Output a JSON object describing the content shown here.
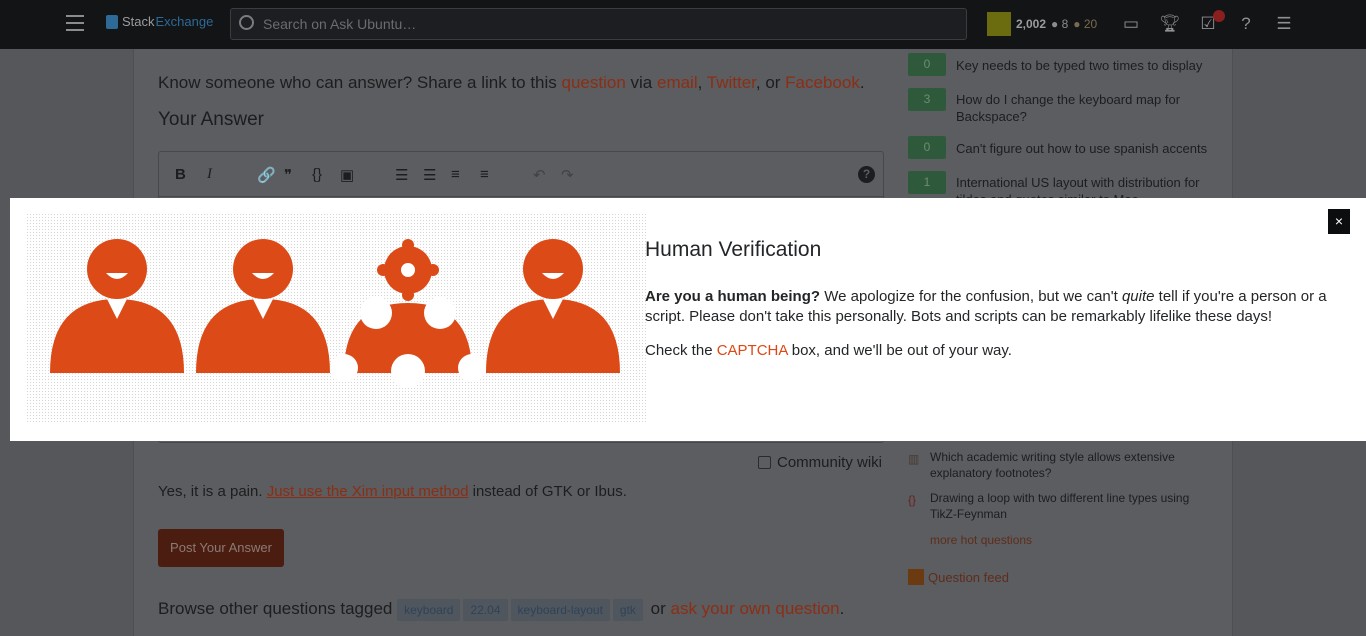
{
  "topbar": {
    "logo_stack": "Stack",
    "logo_exchange": "Exchange",
    "search_placeholder": "Search on Ask Ubuntu…",
    "reputation": "2,002",
    "silver": "● 8",
    "bronze": "● 20"
  },
  "main": {
    "share_prefix": "Know someone who can answer? Share a link to this ",
    "share_question": "question",
    "share_via": " via ",
    "share_email": "email",
    "sep1": ", ",
    "share_twitter": "Twitter",
    "sep2": ", or ",
    "share_facebook": "Facebook",
    "share_end": ".",
    "your_answer": "Your Answer",
    "toolbar": {
      "bold": "B",
      "italic": "I",
      "link": "🔗",
      "quote": "❞",
      "code": "{}",
      "image": "▣",
      "ol": "☰",
      "ul": "☰",
      "heading": "≡",
      "hr": "≡",
      "undo": "↶",
      "redo": "↷",
      "help": "?"
    },
    "community_wiki": "Community wiki",
    "answer_prefix": "Yes, it is a pain. ",
    "answer_link": "Just use the Xim input method",
    "answer_suffix": " instead of GTK or Ibus.",
    "post_button": "Post Your Answer",
    "browse_prefix": "Browse other questions tagged ",
    "tags": [
      "keyboard",
      "22.04",
      "keyboard-layout",
      "gtk"
    ],
    "browse_or": " or ",
    "ask_link": "ask your own question",
    "browse_end": "."
  },
  "linked": [
    {
      "votes": "0",
      "title": "Key needs to be typed two times to display"
    },
    {
      "votes": "3",
      "title": "How do I change the keyboard map for Backspace?"
    },
    {
      "votes": "0",
      "title": "Can't figure out how to use spanish accents"
    },
    {
      "votes": "1",
      "title": "International US layout with distribution for tildes and quotes similar to Mac"
    }
  ],
  "hot": [
    {
      "title": "Which academic writing style allows extensive explanatory footnotes?"
    },
    {
      "title": "Drawing a loop with two different line types using TikZ-Feynman"
    }
  ],
  "more_hot": "more hot questions",
  "feed": "Question feed",
  "modal": {
    "close": "×",
    "title": "Human Verification",
    "bold_q": "Are you a human being?",
    "p1a": " We apologize for the confusion, but we can't ",
    "p1i": "quite",
    "p1b": " tell if you're a person or a script. Please don't take this personally. Bots and scripts can be remarkably lifelike these days!",
    "p2a": "Check the ",
    "p2link": "CAPTCHA",
    "p2b": " box, and we'll be out of your way.",
    "accent": "#dd4814"
  }
}
